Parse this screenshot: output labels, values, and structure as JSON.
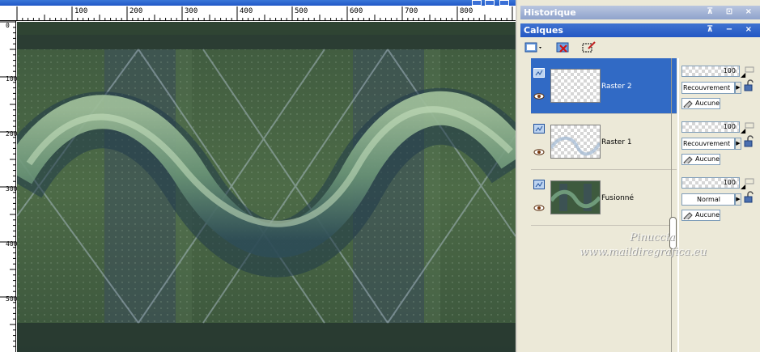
{
  "ruler": {
    "horizontal_labels": [
      "100",
      "200",
      "300",
      "400",
      "500",
      "600",
      "700",
      "800"
    ],
    "vertical_labels": [
      "0",
      "100",
      "200",
      "300",
      "400",
      "500"
    ]
  },
  "palettes": {
    "historique": {
      "title": "Historique"
    },
    "calques": {
      "title": "Calques"
    }
  },
  "layers": [
    {
      "name": "Raster 2",
      "opacity": "100",
      "blend_mode": "Recouvrement",
      "mask": "Aucune",
      "selected": true,
      "visible": true
    },
    {
      "name": "Raster 1",
      "opacity": "100",
      "blend_mode": "Recouvrement",
      "mask": "Aucune",
      "selected": false,
      "visible": true
    },
    {
      "name": "Fusionné",
      "opacity": "100",
      "blend_mode": "Normal",
      "mask": "Aucune",
      "selected": false,
      "visible": true
    }
  ],
  "watermark": {
    "line1": "Pinuccia",
    "line2": "www.maildiregrafica.eu"
  },
  "icons": [
    "new-layer-icon",
    "delete-layer-icon",
    "edit-selection-icon",
    "eye-icon",
    "lock-icon",
    "link-icon",
    "mask-icon",
    "raster-layer-icon"
  ],
  "colors": {
    "selected": "#316ac5",
    "palette_bg": "#ece9d8",
    "header_active": "#2458c4"
  }
}
